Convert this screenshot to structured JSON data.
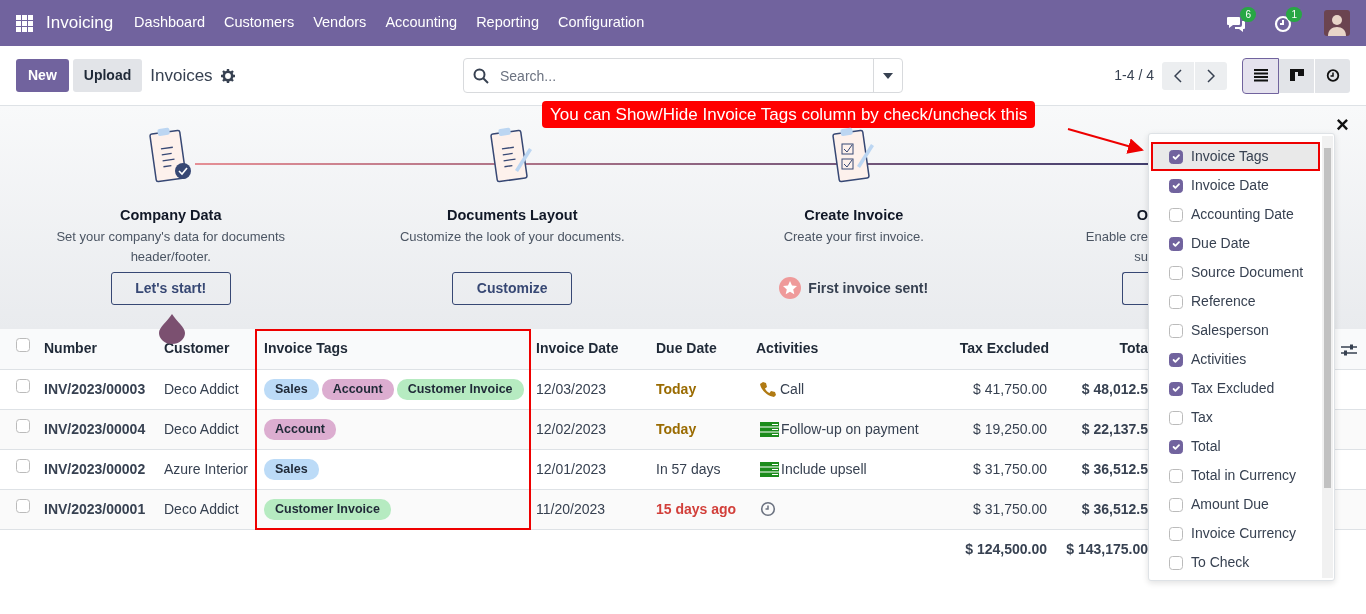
{
  "navbar": {
    "app": "Invoicing",
    "menu": [
      "Dashboard",
      "Customers",
      "Vendors",
      "Accounting",
      "Reporting",
      "Configuration"
    ],
    "messages_count": "6",
    "activities_count": "1"
  },
  "control_panel": {
    "buttons": [
      {
        "label": "New",
        "kind": "primary"
      },
      {
        "label": "Upload",
        "kind": "secondary"
      }
    ],
    "title": "Invoices",
    "search": {
      "placeholder": "Search..."
    },
    "pager": "1-4 / 4",
    "views": [
      {
        "kind": "list",
        "selected": true
      },
      {
        "kind": "kanban",
        "selected": false
      },
      {
        "kind": "activity",
        "selected": false
      }
    ]
  },
  "onboarding": {
    "steps": [
      {
        "kind": "check",
        "title": "Company Data",
        "description": [
          "Set your company's data for documents",
          "header/footer."
        ],
        "action": {
          "kind": "button",
          "label": "Let's start!"
        }
      },
      {
        "kind": "pen",
        "title": "Documents Layout",
        "description": [
          "Customize the look of your documents."
        ],
        "action": {
          "kind": "button",
          "label": "Customize"
        }
      },
      {
        "kind": "checklist",
        "title": "Create Invoice",
        "description": [
          "Create your first invoice."
        ],
        "action": {
          "kind": "done",
          "label": "First invoice sent!"
        }
      },
      {
        "covered": true,
        "title": "O",
        "description": [
          "Enable cre",
          "su"
        ],
        "action": {
          "kind": "button"
        }
      }
    ]
  },
  "annotation": {
    "text": "You can Show/Hide Invoice Tags column by check/uncheck this"
  },
  "table": {
    "all_selected": false,
    "columns": [
      "Number",
      "Customer",
      "Invoice Tags",
      "Invoice Date",
      "Due Date",
      "Activities",
      "Tax Excluded",
      "Tota"
    ],
    "rows": [
      {
        "selected": false,
        "number": "INV/2023/00003",
        "customer": "Deco Addict",
        "tags": [
          {
            "label": "Sales",
            "color": "#bcdbf7"
          },
          {
            "label": "Account",
            "color": "#dcadd0"
          },
          {
            "label": "Customer Invoice",
            "color": "#b6ebc1"
          }
        ],
        "invoice_date": "12/03/2023",
        "due_date": {
          "text": "Today",
          "kind": "today"
        },
        "activity": {
          "kind": "call",
          "label": "Call"
        },
        "tax_excluded": "$ 41,750.00",
        "total": "$ 48,012.5"
      },
      {
        "selected": false,
        "number": "INV/2023/00004",
        "customer": "Deco Addict",
        "tags": [
          {
            "label": "Account",
            "color": "#dcadd0"
          }
        ],
        "invoice_date": "12/02/2023",
        "due_date": {
          "text": "Today",
          "kind": "today"
        },
        "activity": {
          "kind": "todo",
          "label": "Follow-up on payment"
        },
        "tax_excluded": "$ 19,250.00",
        "total": "$ 22,137.5"
      },
      {
        "selected": false,
        "number": "INV/2023/00002",
        "customer": "Azure Interior",
        "tags": [
          {
            "label": "Sales",
            "color": "#bcdbf7"
          }
        ],
        "invoice_date": "12/01/2023",
        "due_date": {
          "text": "In 57 days",
          "kind": "future"
        },
        "activity": {
          "kind": "todo",
          "label": "Include upsell"
        },
        "tax_excluded": "$ 31,750.00",
        "total": "$ 36,512.5"
      },
      {
        "selected": false,
        "number": "INV/2023/00001",
        "customer": "Deco Addict",
        "tags": [
          {
            "label": "Customer Invoice",
            "color": "#b6ebc1"
          }
        ],
        "invoice_date": "11/20/2023",
        "due_date": {
          "text": "15 days ago",
          "kind": "overdue"
        },
        "activity": {
          "kind": "none"
        },
        "tax_excluded": "$ 31,750.00",
        "total": "$ 36,512.5"
      }
    ],
    "totals": {
      "tax_excluded": "$ 124,500.00",
      "total": "$ 143,175.00"
    }
  },
  "optional_columns": {
    "close": "×",
    "items": [
      {
        "label": "Invoice Tags",
        "checked": true,
        "highlighted": true
      },
      {
        "label": "Invoice Date",
        "checked": true,
        "highlighted": false
      },
      {
        "label": "Accounting Date",
        "checked": false,
        "highlighted": false
      },
      {
        "label": "Due Date",
        "checked": true,
        "highlighted": false
      },
      {
        "label": "Source Document",
        "checked": false,
        "highlighted": false
      },
      {
        "label": "Reference",
        "checked": false,
        "highlighted": false
      },
      {
        "label": "Salesperson",
        "checked": false,
        "highlighted": false
      },
      {
        "label": "Activities",
        "checked": true,
        "highlighted": false
      },
      {
        "label": "Tax Excluded",
        "checked": true,
        "highlighted": false
      },
      {
        "label": "Tax",
        "checked": false,
        "highlighted": false
      },
      {
        "label": "Total",
        "checked": true,
        "highlighted": false
      },
      {
        "label": "Total in Currency",
        "checked": false,
        "highlighted": false
      },
      {
        "label": "Amount Due",
        "checked": false,
        "highlighted": false
      },
      {
        "label": "Invoice Currency",
        "checked": false,
        "highlighted": false
      },
      {
        "label": "To Check",
        "checked": false,
        "highlighted": false
      }
    ]
  }
}
